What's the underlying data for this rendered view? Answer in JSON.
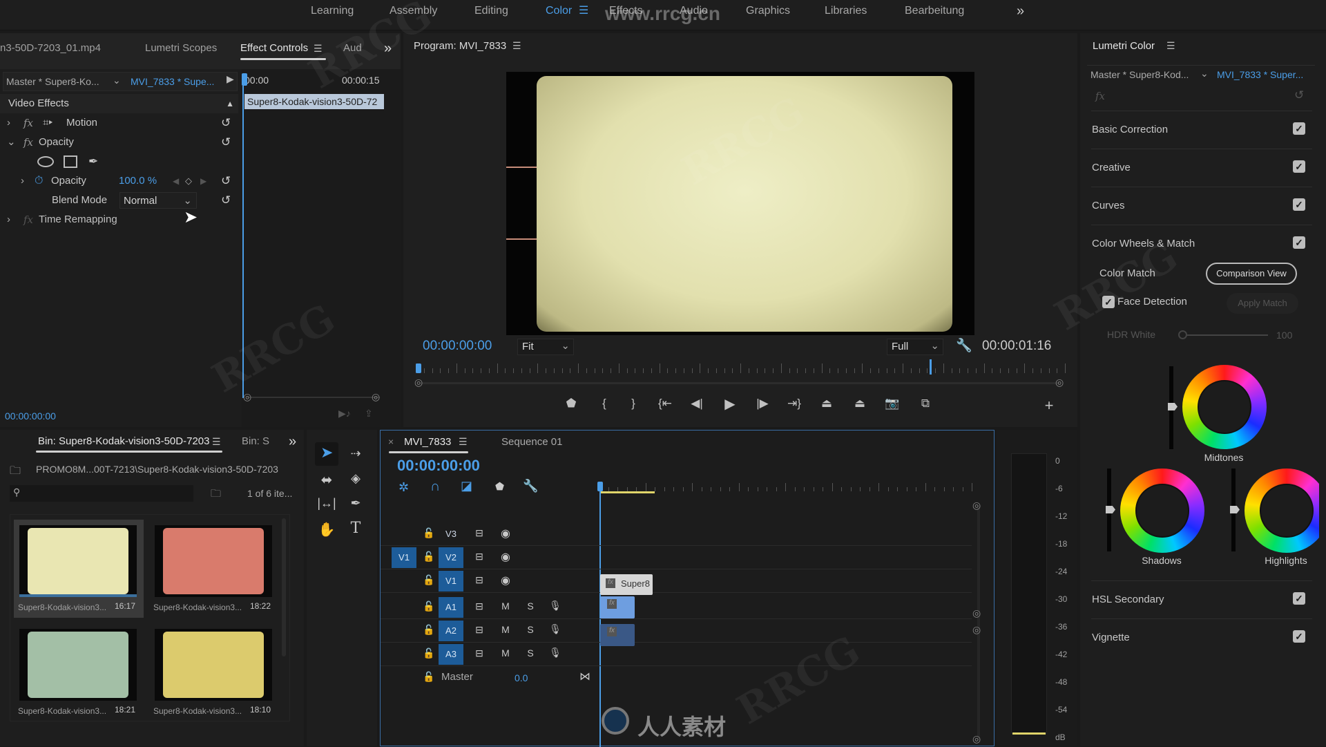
{
  "workspaces": {
    "items": [
      {
        "label": "Learning",
        "active": false
      },
      {
        "label": "Assembly",
        "active": false
      },
      {
        "label": "Editing",
        "active": false
      },
      {
        "label": "Color",
        "active": true
      },
      {
        "label": "Effects",
        "active": false
      },
      {
        "label": "Audio",
        "active": false
      },
      {
        "label": "Graphics",
        "active": false
      },
      {
        "label": "Libraries",
        "active": false
      },
      {
        "label": "Bearbeitung",
        "active": false
      }
    ],
    "more": "»",
    "watermark": "www.rrcg.cn"
  },
  "source_panel": {
    "tabs": [
      "n3-50D-7203_01.mp4",
      "Lumetri Scopes",
      "Effect Controls",
      "Aud"
    ],
    "active_tab": "Effect Controls",
    "more": "»",
    "master_label": "Master * Super8-Ko...",
    "clip_label": "MVI_7833 * Supe...",
    "ruler_start": "00:00",
    "ruler_end": "00:00:15",
    "clip_bar": "Super8-Kodak-vision3-50D-72",
    "section": "Video Effects",
    "effects": {
      "motion": "Motion",
      "opacity": "Opacity",
      "opacity_param": "Opacity",
      "opacity_value": "100.0 %",
      "blend_label": "Blend Mode",
      "blend_value": "Normal",
      "time_remap": "Time Remapping",
      "fx": "fx"
    },
    "timecode": "00:00:00:00"
  },
  "program": {
    "title": "Program: MVI_7833",
    "timecode": "00:00:00:00",
    "fit": "Fit",
    "resolution": "Full",
    "duration": "00:00:01:16",
    "playhead_fraction": 0.0,
    "out_marker_fraction": 0.8
  },
  "bin": {
    "tab": "Bin: Super8-Kodak-vision3-50D-7203",
    "tab2": "Bin: S",
    "more": "»",
    "path": "PROMO8M...00T-7213\\Super8-Kodak-vision3-50D-7203",
    "search_placeholder": "",
    "count": "1 of 6 ite...",
    "items": [
      {
        "name": "Super8-Kodak-vision3...",
        "duration": "16:17",
        "color": "#e9e6b2",
        "selected": true
      },
      {
        "name": "Super8-Kodak-vision3...",
        "duration": "18:22",
        "color": "#d97b6c",
        "selected": false
      },
      {
        "name": "Super8-Kodak-vision3...",
        "duration": "18:21",
        "color": "#a3bfa6",
        "selected": false
      },
      {
        "name": "Super8-Kodak-vision3...",
        "duration": "18:10",
        "color": "#dccb6d",
        "selected": false
      }
    ]
  },
  "timeline": {
    "tabs": [
      "MVI_7833",
      "Sequence 01"
    ],
    "close": "×",
    "timecode": "00:00:00:00",
    "source_patch": "V1",
    "tracks": [
      {
        "name": "V3",
        "type": "video",
        "targeted": false
      },
      {
        "name": "V2",
        "type": "video",
        "targeted": true
      },
      {
        "name": "V1",
        "type": "video",
        "targeted": true
      },
      {
        "name": "A1",
        "type": "audio",
        "targeted": true
      },
      {
        "name": "A2",
        "type": "audio",
        "targeted": true
      },
      {
        "name": "A3",
        "type": "audio",
        "targeted": true
      }
    ],
    "mute": "M",
    "solo": "S",
    "master_label": "Master",
    "master_value": "0.0",
    "clip_label": "Super8",
    "fx": "fx"
  },
  "meter": {
    "scale": [
      "0",
      "-6",
      "-12",
      "-18",
      "-24",
      "-30",
      "-36",
      "-42",
      "-48",
      "-54",
      "dB"
    ]
  },
  "lumetri": {
    "title": "Lumetri Color",
    "master_label": "Master * Super8-Kod...",
    "clip_label": "MVI_7833 * Super...",
    "fx": "fx",
    "sections": [
      {
        "label": "Basic Correction",
        "enabled": true
      },
      {
        "label": "Creative",
        "enabled": true
      },
      {
        "label": "Curves",
        "enabled": true
      },
      {
        "label": "Color Wheels & Match",
        "enabled": true
      }
    ],
    "color_match": "Color Match",
    "comparison_view": "Comparison View",
    "face_detection": "Face Detection",
    "face_detection_checked": true,
    "apply_match": "Apply Match",
    "hdr_white_label": "HDR White",
    "hdr_white_value": "100",
    "wheels": {
      "midtones": "Midtones",
      "shadows": "Shadows",
      "highlights": "Highlights"
    },
    "sections2": [
      {
        "label": "HSL Secondary",
        "enabled": true
      },
      {
        "label": "Vignette",
        "enabled": true
      }
    ]
  },
  "watermarks": {
    "logo_text": "人人素材"
  }
}
